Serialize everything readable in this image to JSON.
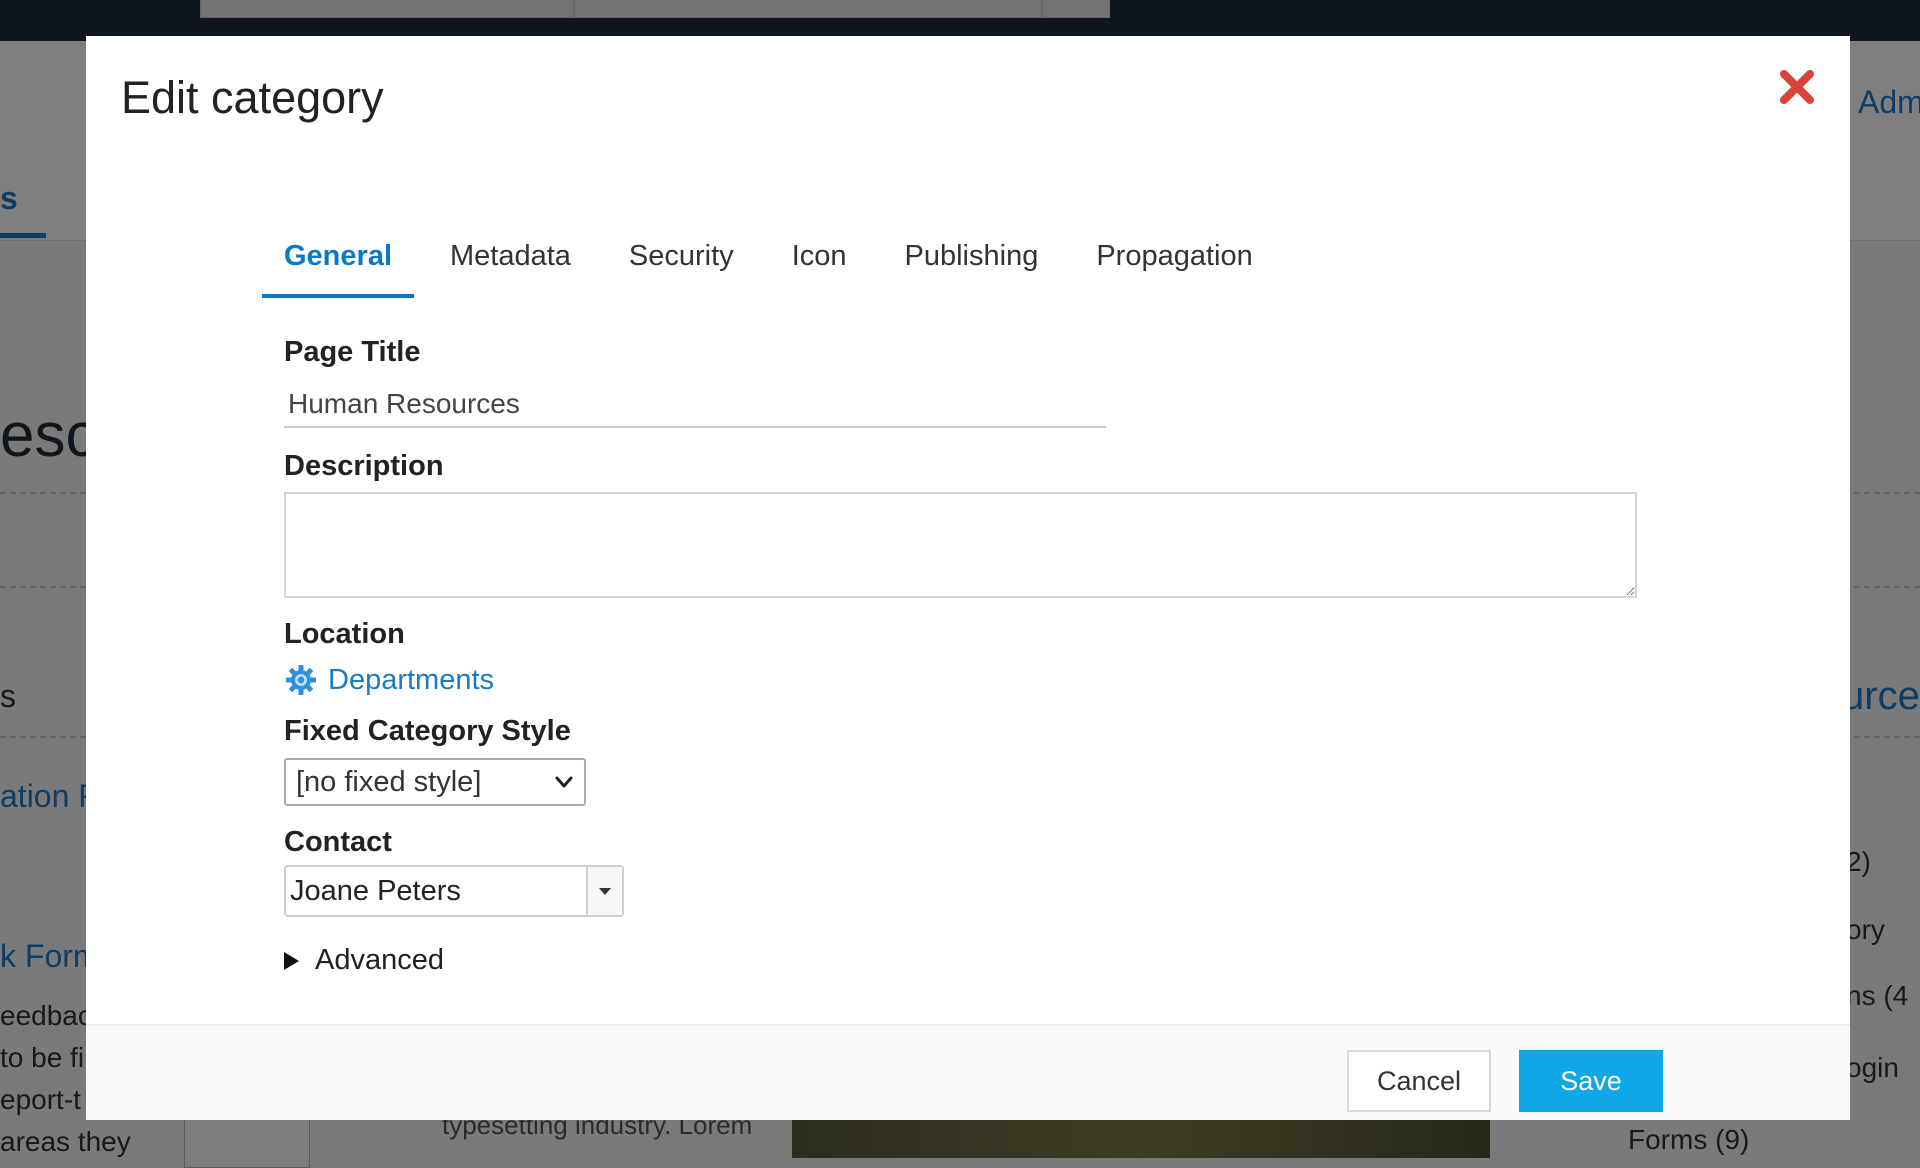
{
  "background": {
    "header_link": "Adm",
    "nav_fragment": "s",
    "heading_fragment": "esc",
    "left_fragments": [
      "s",
      "ation F",
      "k Form",
      "eedbac",
      "to be fi",
      "eport-t",
      "areas they"
    ],
    "right_fragments": [
      "urce",
      "2)",
      "ory",
      "ns (4",
      "ogin",
      "Forms (9)"
    ],
    "bottom_text": "typesetting industry. Lorem"
  },
  "modal": {
    "title": "Edit category",
    "close_label": "Close",
    "tabs": [
      {
        "label": "General",
        "active": true
      },
      {
        "label": "Metadata",
        "active": false
      },
      {
        "label": "Security",
        "active": false
      },
      {
        "label": "Icon",
        "active": false
      },
      {
        "label": "Publishing",
        "active": false
      },
      {
        "label": "Propagation",
        "active": false
      }
    ],
    "page_title": {
      "label": "Page Title",
      "value": "Human Resources"
    },
    "description": {
      "label": "Description",
      "value": ""
    },
    "location": {
      "label": "Location",
      "value": "Departments",
      "icon": "gear-icon"
    },
    "fixed_style": {
      "label": "Fixed Category Style",
      "value": "[no fixed style]"
    },
    "contact": {
      "label": "Contact",
      "value": "Joane Peters"
    },
    "advanced": {
      "label": "Advanced"
    },
    "footer": {
      "cancel_label": "Cancel",
      "save_label": "Save"
    }
  },
  "colors": {
    "accent": "#0a78c8",
    "save_button": "#10a7e9",
    "close_icon": "#d9443a",
    "link": "#1a7ac4"
  }
}
